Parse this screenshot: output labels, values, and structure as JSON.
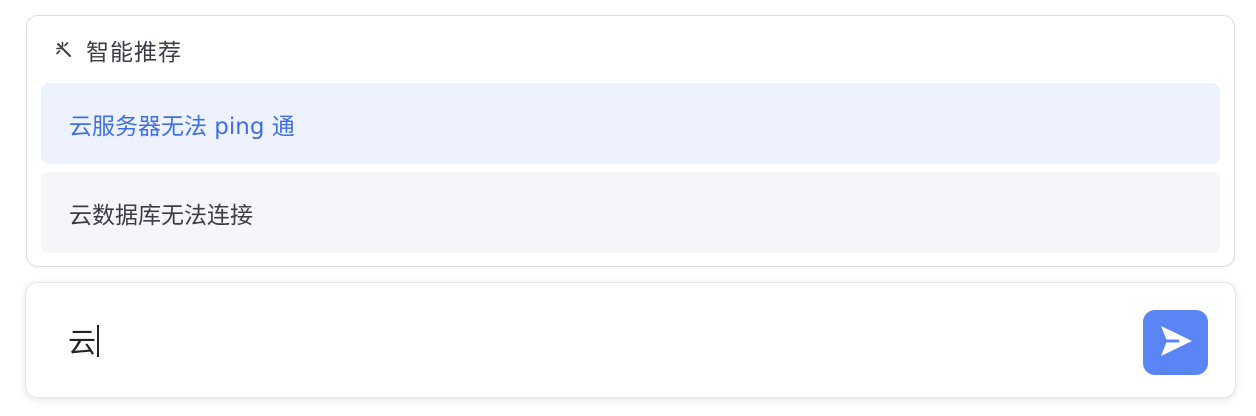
{
  "suggestions": {
    "title": "智能推荐",
    "title_icon": "magic-wand-icon",
    "items": [
      {
        "label": "云服务器无法 ping 通",
        "state": "highlighted"
      },
      {
        "label": "云数据库无法连接",
        "state": "normal"
      }
    ]
  },
  "input": {
    "value": "云"
  },
  "send": {
    "icon": "send-icon",
    "color": "#5b84f5"
  },
  "colors": {
    "accent": "#3f6fe6",
    "highlight_bg": "#eef2fe",
    "item_bg": "#f5f6f9"
  }
}
